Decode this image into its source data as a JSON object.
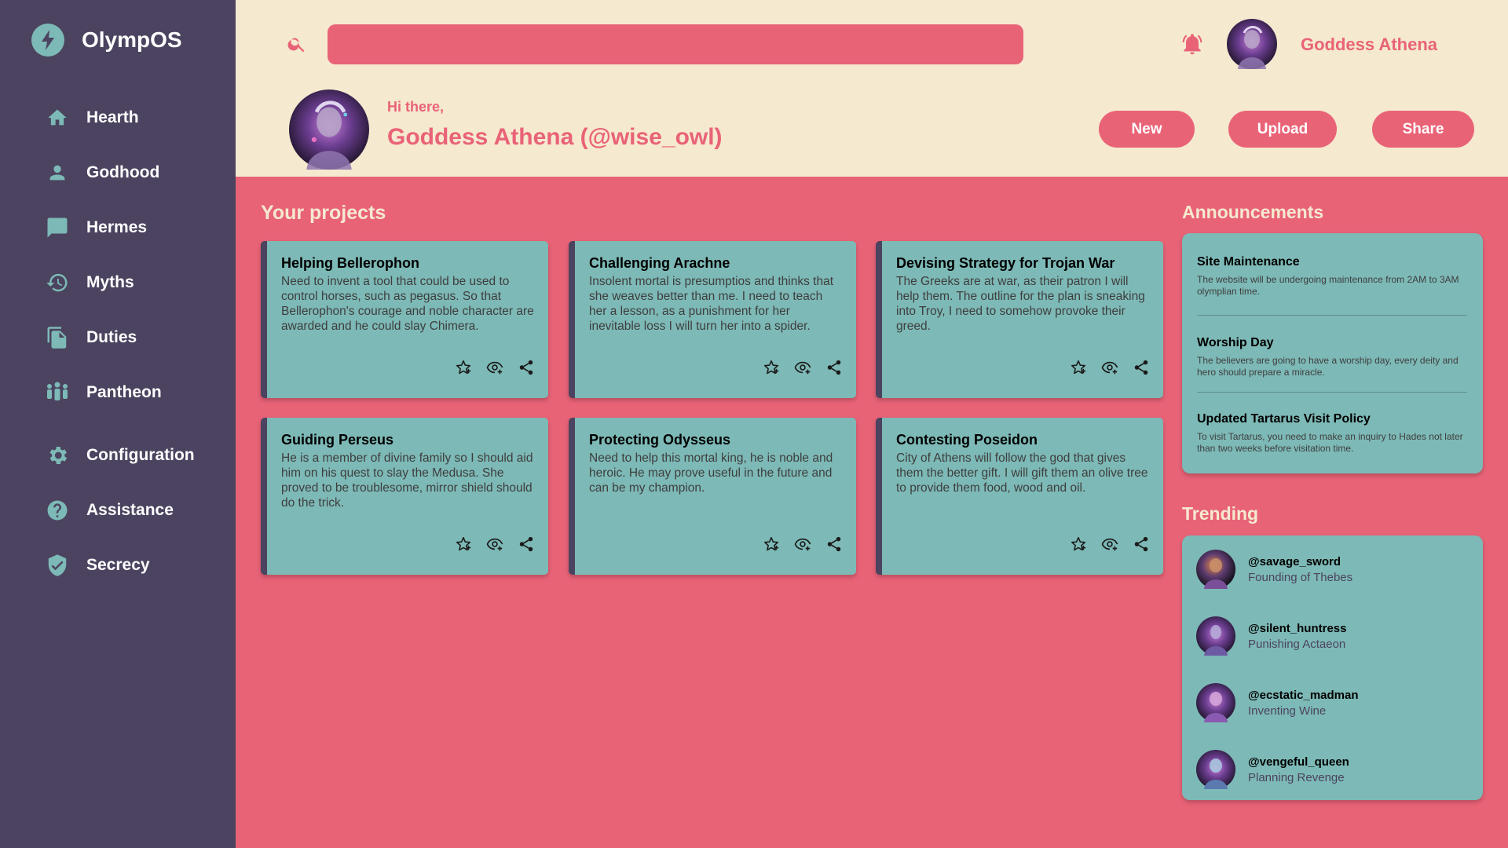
{
  "app": {
    "name": "OlympOS"
  },
  "sidebar": {
    "items": [
      {
        "label": "Hearth",
        "icon": "home-icon"
      },
      {
        "label": "Godhood",
        "icon": "person-icon"
      },
      {
        "label": "Hermes",
        "icon": "chat-icon"
      },
      {
        "label": "Myths",
        "icon": "history-icon"
      },
      {
        "label": "Duties",
        "icon": "document-icon"
      },
      {
        "label": "Pantheon",
        "icon": "group-icon"
      },
      {
        "label": "Configuration",
        "icon": "gear-icon"
      },
      {
        "label": "Assistance",
        "icon": "help-icon"
      },
      {
        "label": "Secrecy",
        "icon": "shield-icon"
      }
    ]
  },
  "header": {
    "search_placeholder": "",
    "user_name": "Goddess Athena",
    "greeting": "Hi there,",
    "full_name": "Goddess Athena (@wise_owl)",
    "buttons": {
      "new": "New",
      "upload": "Upload",
      "share": "Share"
    }
  },
  "projects": {
    "title": "Your projects",
    "items": [
      {
        "title": "Helping Bellerophon",
        "description": "Need to invent a tool that could be used to control horses, such as pegasus. So that Bellerophon's courage and noble character are awarded and he could slay Chimera."
      },
      {
        "title": "Challenging Arachne",
        "description": "Insolent mortal is presumptios and thinks that she weaves better than me. I need to teach her a lesson, as a punishment for her inevitable loss I will turn her into a spider."
      },
      {
        "title": "Devising Strategy for Trojan War",
        "description": "The Greeks are at war, as their patron I will help them. The outline for the plan is sneaking into Troy, I need to somehow provoke their greed."
      },
      {
        "title": "Guiding Perseus",
        "description": "He is a member of divine family so I should aid him on his quest to slay the Medusa. She proved to be troublesome, mirror shield should do the trick."
      },
      {
        "title": "Protecting Odysseus",
        "description": "Need to help this mortal king, he is noble and heroic. He may prove useful in the future and can be my champion."
      },
      {
        "title": "Contesting Poseidon",
        "description": "City of Athens will follow the god that gives them the better gift. I will gift them an olive tree to provide them food, wood and oil."
      }
    ]
  },
  "announcements": {
    "title": "Announcements",
    "items": [
      {
        "title": "Site Maintenance",
        "text": "The website will be undergoing maintenance from 2AM to 3AM olymplian time."
      },
      {
        "title": "Worship Day",
        "text": "The believers are going to have a worship day, every deity and hero should prepare a miracle."
      },
      {
        "title": "Updated Tartarus Visit Policy",
        "text": "To visit Tartarus, you need to make an inquiry to Hades not later than two weeks before visitation time."
      }
    ]
  },
  "trending": {
    "title": "Trending",
    "items": [
      {
        "handle": "@savage_sword",
        "subtitle": "Founding of Thebes"
      },
      {
        "handle": "@silent_huntress",
        "subtitle": "Punishing Actaeon"
      },
      {
        "handle": "@ecstatic_madman",
        "subtitle": "Inventing Wine"
      },
      {
        "handle": "@vengeful_queen",
        "subtitle": "Planning Revenge"
      }
    ]
  },
  "colors": {
    "sidebar_bg": "#4b435f",
    "header_bg": "#f5e9cf",
    "main_bg": "#e96377",
    "card_bg": "#7db9b6",
    "accent": "#e96377"
  }
}
